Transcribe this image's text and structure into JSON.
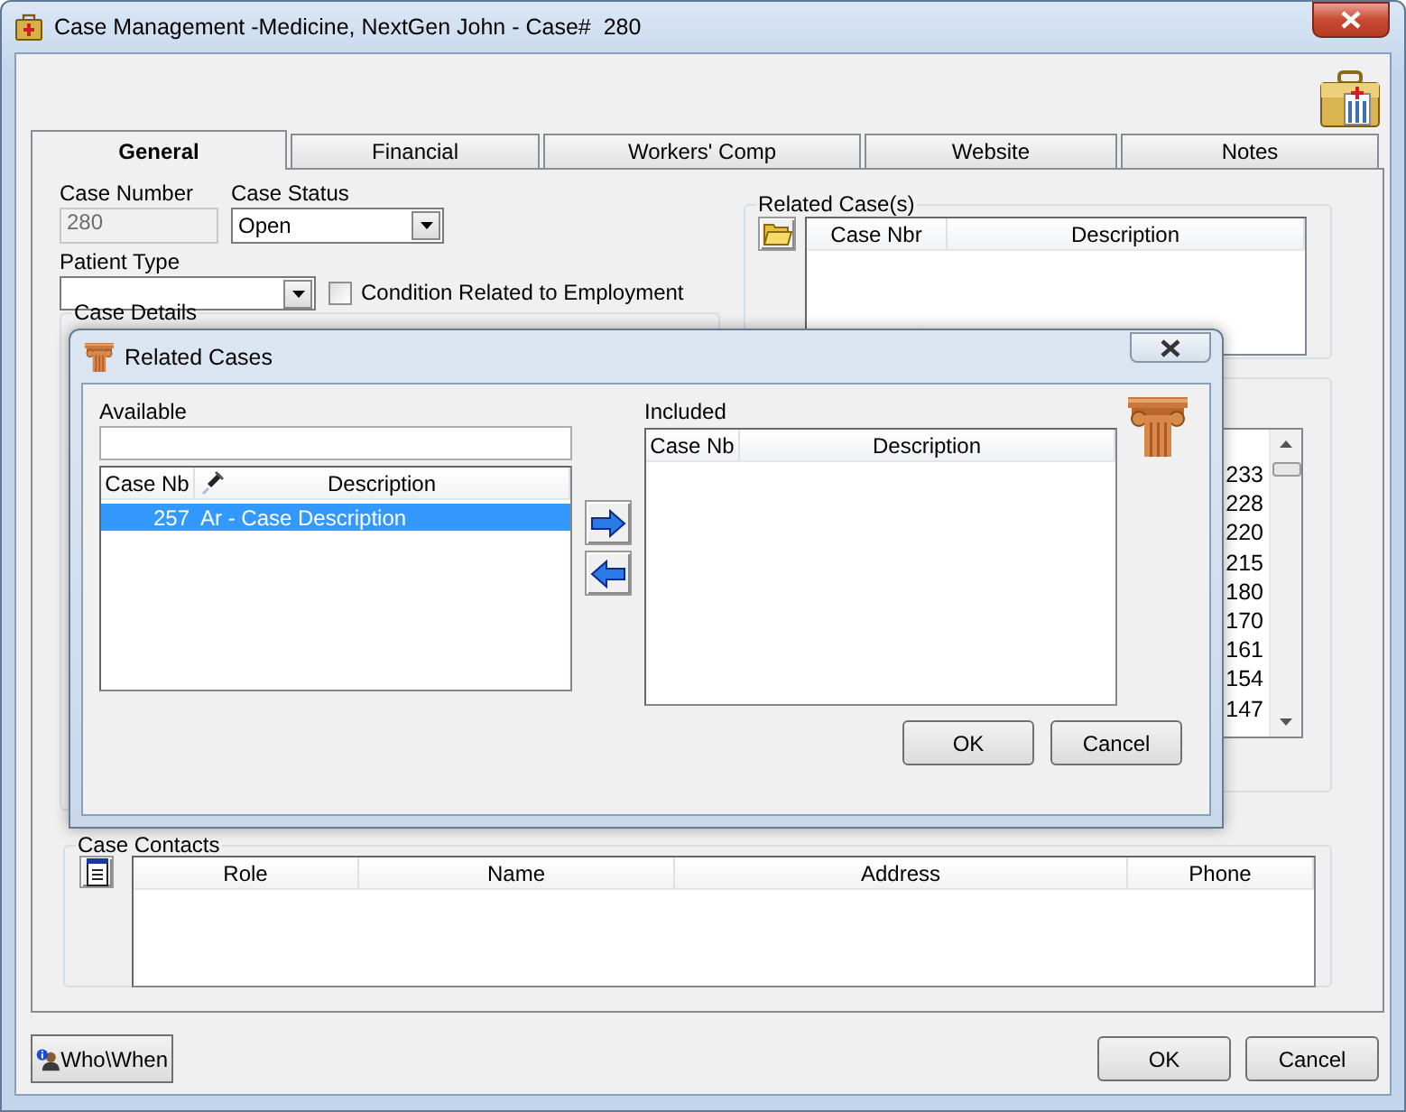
{
  "window": {
    "title": "Case Management -Medicine, NextGen John - Case#  280"
  },
  "tabs": [
    {
      "label": "General",
      "selected": true
    },
    {
      "label": "Financial",
      "selected": false
    },
    {
      "label": "Workers' Comp",
      "selected": false
    },
    {
      "label": "Website",
      "selected": false
    },
    {
      "label": "Notes",
      "selected": false
    }
  ],
  "general": {
    "case_number": {
      "label": "Case Number",
      "value": "280",
      "disabled": true
    },
    "case_status": {
      "label": "Case Status",
      "value": "Open"
    },
    "patient_type": {
      "label": "Patient Type"
    },
    "condition_related": {
      "label": "Condition Related to Employment",
      "checked": false
    },
    "case_details": {
      "label": "Case Details"
    }
  },
  "related_cases": {
    "label": "Related Case(s)",
    "columns": [
      "Case Nbr",
      "Description"
    ]
  },
  "list_values": [
    "233",
    "228",
    "220",
    "215",
    "180",
    "170",
    "161",
    "154",
    "147"
  ],
  "case_contacts": {
    "label": "Case Contacts",
    "columns": [
      "Role",
      "Name",
      "Address",
      "Phone"
    ]
  },
  "footer": {
    "who_when": "Who\\When",
    "ok": "OK",
    "cancel": "Cancel"
  },
  "dialog": {
    "title": "Related Cases",
    "available": {
      "label": "Available",
      "columns": [
        "Case Nb",
        "Description"
      ],
      "rows": [
        {
          "case_nb": "257",
          "description": "Ar - Case Description",
          "selected": true
        }
      ]
    },
    "included": {
      "label": "Included",
      "columns": [
        "Case Nb",
        "Description"
      ]
    },
    "buttons": [
      "OK",
      "Cancel"
    ]
  }
}
